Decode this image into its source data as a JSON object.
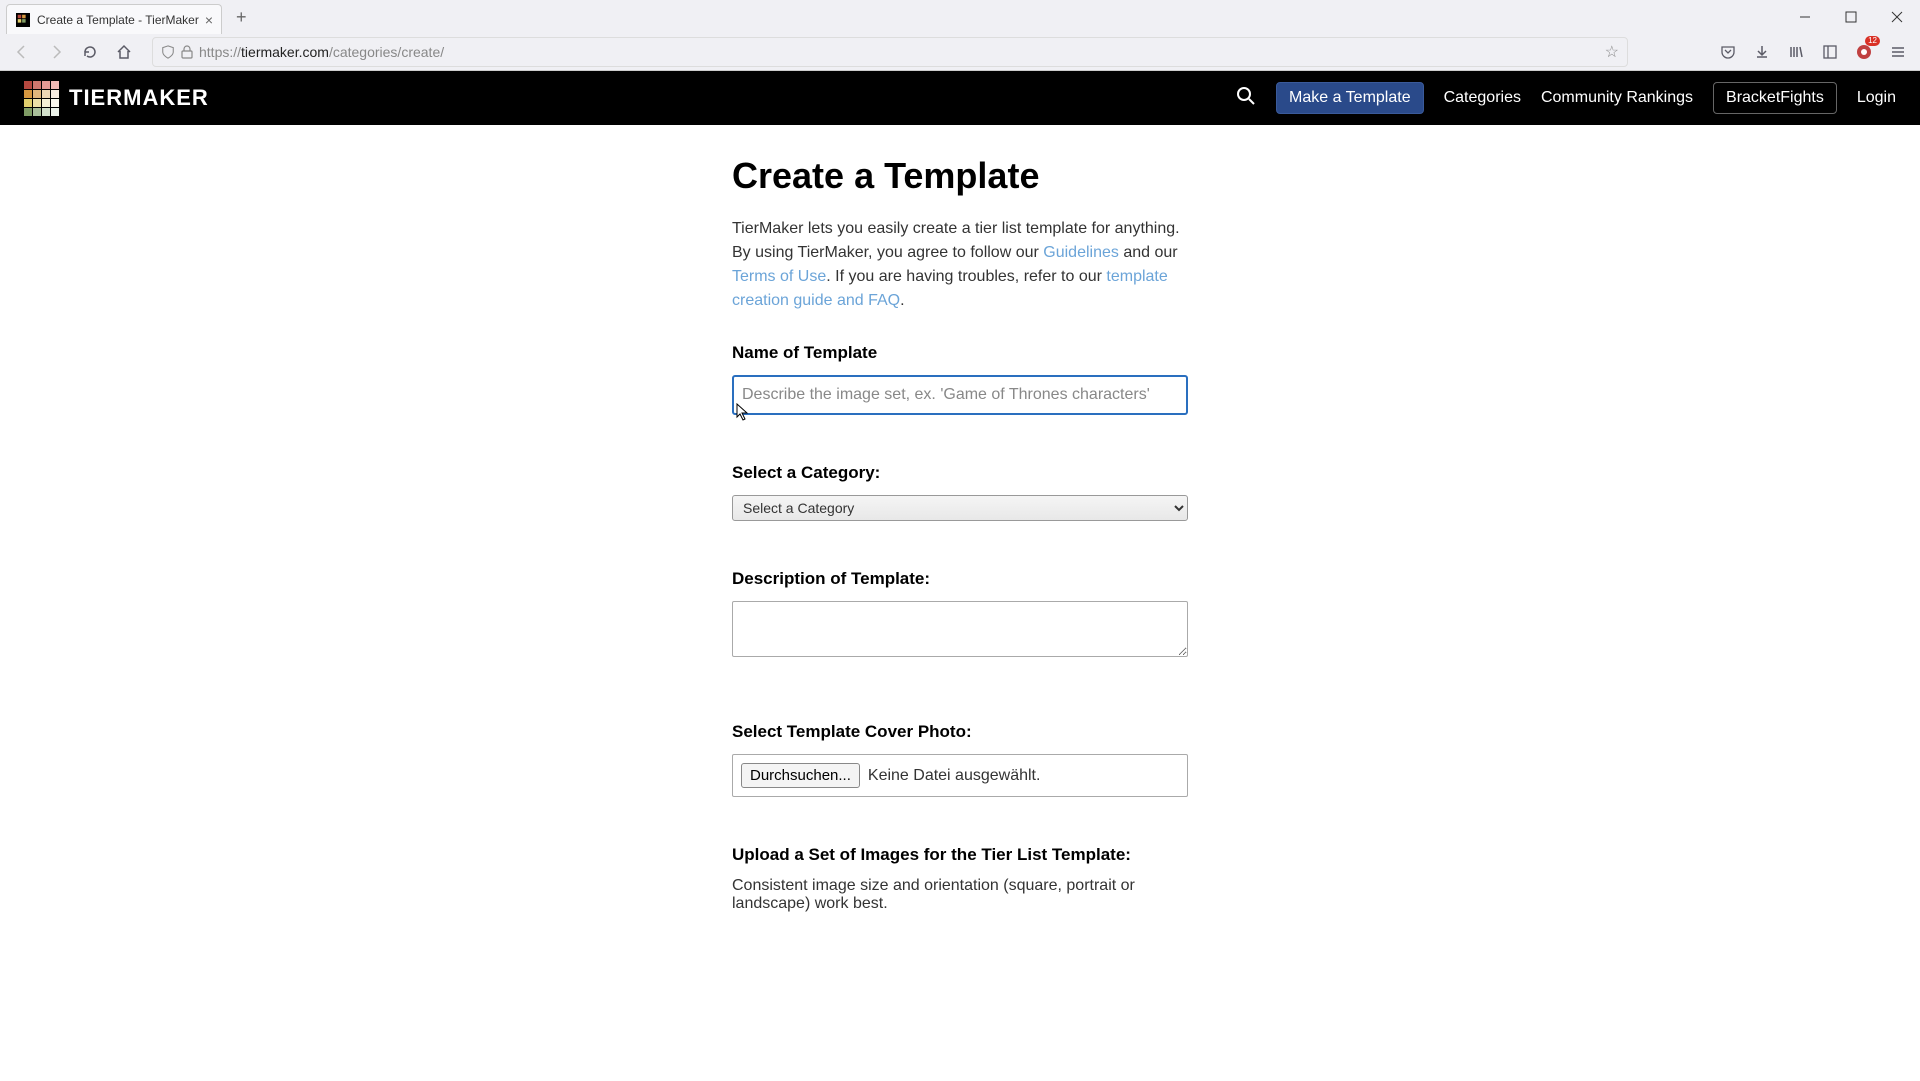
{
  "browser": {
    "tab_title": "Create a Template - TierMaker",
    "url_prefix": "https://",
    "url_domain": "tiermaker.com",
    "url_path": "/categories/create/"
  },
  "header": {
    "brand": "TIERMAKER",
    "nav": {
      "make_template": "Make a Template",
      "categories": "Categories",
      "community": "Community Rankings",
      "bracketfights": "BracketFights",
      "login": "Login"
    }
  },
  "page": {
    "title": "Create a Template",
    "intro_1": "TierMaker lets you easily create a tier list template for anything. By using TierMaker, you agree to follow our ",
    "link_guidelines": "Guidelines",
    "intro_and": " and our ",
    "link_terms": "Terms of Use",
    "intro_2": ". If you are having troubles, refer to our ",
    "link_faq": "template creation guide and FAQ",
    "intro_end": ".",
    "labels": {
      "name": "Name of Template",
      "category": "Select a Category:",
      "description": "Description of Template:",
      "cover": "Select Template Cover Photo:",
      "upload": "Upload a Set of Images for the Tier List Template:"
    },
    "name_placeholder": "Describe the image set, ex. 'Game of Thrones characters'",
    "category_selected": "Select a Category",
    "file_button": "Durchsuchen...",
    "file_status": "Keine Datei ausgewählt.",
    "upload_hint": "Consistent image size and orientation (square, portrait or landscape) work best."
  },
  "logo_colors": [
    "#b5483f",
    "#d0776e",
    "#e59a94",
    "#f1bab5",
    "#d6973f",
    "#e1b77c",
    "#edd7b5",
    "#f6ece0",
    "#e0ce6c",
    "#ece0a8",
    "#f5f0d6",
    "#faf8ee",
    "#7f9c65",
    "#a9bf9a",
    "#d2e0cb",
    "#edf3ea"
  ]
}
